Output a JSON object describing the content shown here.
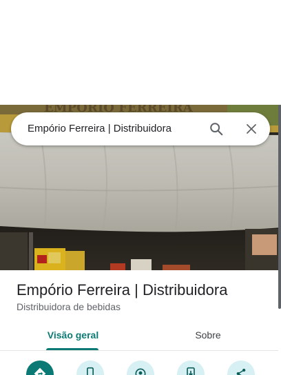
{
  "search": {
    "query": "Empório Ferreira | Distribuidora",
    "search_icon": "search-icon",
    "close_icon": "close-icon"
  },
  "photo": {
    "storefront_sign_text": "EMPÓRIO FERREIRA"
  },
  "place": {
    "name": "Empório Ferreira | Distribuidora",
    "category": "Distribuidora de bebidas"
  },
  "tabs": [
    {
      "label": "Visão geral",
      "active": true
    },
    {
      "label": "Sobre",
      "active": false
    }
  ],
  "actions": [
    {
      "icon": "directions-icon",
      "style": "filled"
    },
    {
      "icon": "phone-icon",
      "style": "tonal"
    },
    {
      "icon": "nearby-icon",
      "style": "tonal"
    },
    {
      "icon": "send-to-phone-icon",
      "style": "tonal"
    },
    {
      "icon": "share-icon",
      "style": "tonal"
    }
  ],
  "colors": {
    "accent": "#0b7a75",
    "tonal_button": "#d7f0f4",
    "title_text": "#202124",
    "secondary_text": "#5f6368"
  }
}
